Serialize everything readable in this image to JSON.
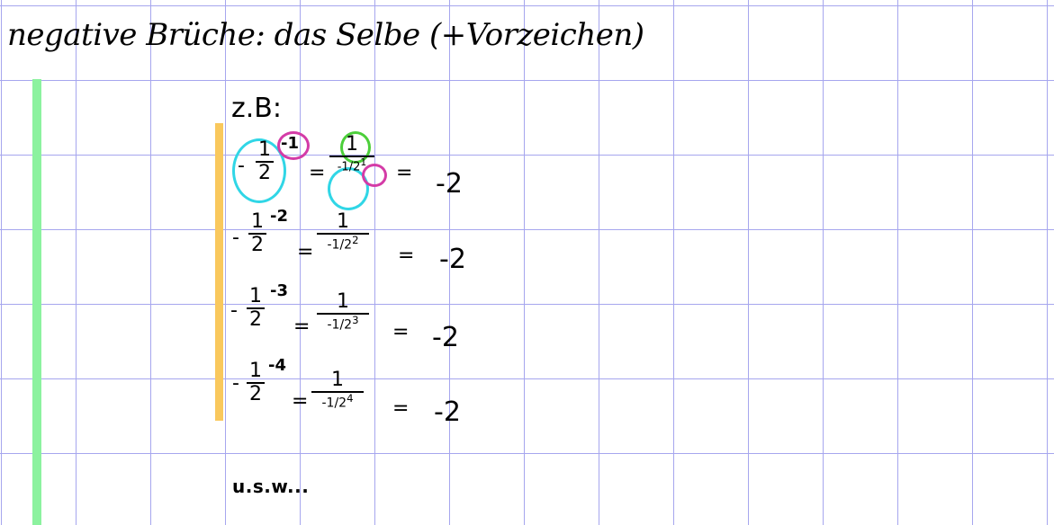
{
  "title": "negative Brüche: das Selbe (+Vorzeichen)",
  "example_label": "z.B:",
  "colors": {
    "grid": "#a6a6ee",
    "green_bar": "#8cf29f",
    "orange_bar": "#f9c85d",
    "cyan_circle": "#30d6e6",
    "magenta_circle": "#d43ba7",
    "green_circle": "#4ccf3a"
  },
  "equations": [
    {
      "lhs": {
        "sign": "-",
        "num": "1",
        "den": "2",
        "exp": "-1"
      },
      "rhs": {
        "num": "1",
        "den_sign": "-",
        "den_num": "1",
        "den_den": "2",
        "den_exp": "1"
      },
      "result": "-2"
    },
    {
      "lhs": {
        "sign": "-",
        "num": "1",
        "den": "2",
        "exp": "-2"
      },
      "rhs": {
        "num": "1",
        "den_sign": "-",
        "den_num": "1",
        "den_den": "2",
        "den_exp": "2"
      },
      "result": "-2"
    },
    {
      "lhs": {
        "sign": "-",
        "num": "1",
        "den": "2",
        "exp": "-3"
      },
      "rhs": {
        "num": "1",
        "den_sign": "-",
        "den_num": "1",
        "den_den": "2",
        "den_exp": "3"
      },
      "result": "-2"
    },
    {
      "lhs": {
        "sign": "-",
        "num": "1",
        "den": "2",
        "exp": "-4"
      },
      "rhs": {
        "num": "1",
        "den_sign": "-",
        "den_num": "1",
        "den_den": "2",
        "den_exp": "4"
      },
      "result": "-2"
    }
  ],
  "equals_sign": "=",
  "continuation": "u.s.w..."
}
